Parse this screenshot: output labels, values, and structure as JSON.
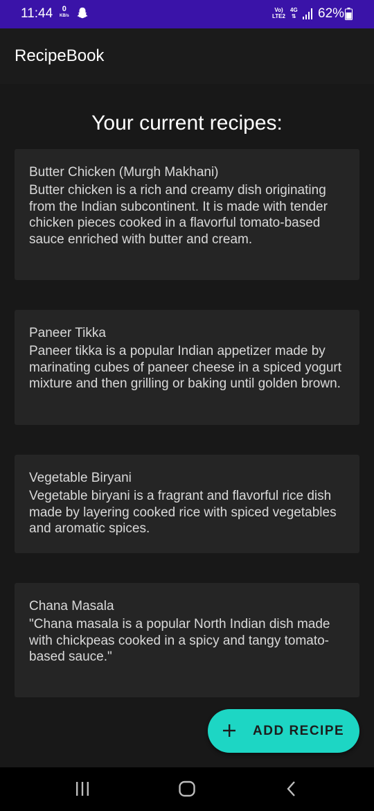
{
  "status_bar": {
    "time": "11:44",
    "data_rate_value": "0",
    "data_rate_unit": "KB/s",
    "network_line1": "Vo)",
    "network_line2": "LTE2",
    "network_type": "4G",
    "battery_percent": "62%",
    "icons": [
      "snapchat-ghost-icon",
      "signal-bars-icon",
      "battery-icon"
    ]
  },
  "app_bar": {
    "title": "RecipeBook"
  },
  "main": {
    "heading": "Your current recipes:",
    "recipes": [
      {
        "name": "Butter Chicken (Murgh Makhani)",
        "description": "Butter chicken is a rich and creamy dish originating from the Indian subcontinent. It is made with tender chicken pieces cooked in a flavorful tomato-based sauce enriched with butter and cream."
      },
      {
        "name": "Paneer Tikka",
        "description": "Paneer tikka is a popular Indian appetizer made by marinating cubes of paneer cheese in a spiced yogurt mixture and then grilling or baking until golden brown."
      },
      {
        "name": "Vegetable Biryani",
        "description": "Vegetable biryani is a fragrant and flavorful rice dish made by layering cooked rice with spiced vegetables and aromatic spices."
      },
      {
        "name": "Chana Masala",
        "description": "\"Chana masala is a popular North Indian dish made with chickpeas cooked in a spicy and tangy tomato-based sauce.\""
      }
    ]
  },
  "fab": {
    "icon": "plus-icon",
    "label": "ADD RECIPE"
  },
  "nav_bar": {
    "icons": [
      "recent-apps-icon",
      "home-icon",
      "back-icon"
    ]
  },
  "colors": {
    "status_bar": "#3a13a8",
    "app_bar": "#1b1b1b",
    "background": "#181818",
    "card": "#252525",
    "accent": "#1dd6c4"
  }
}
